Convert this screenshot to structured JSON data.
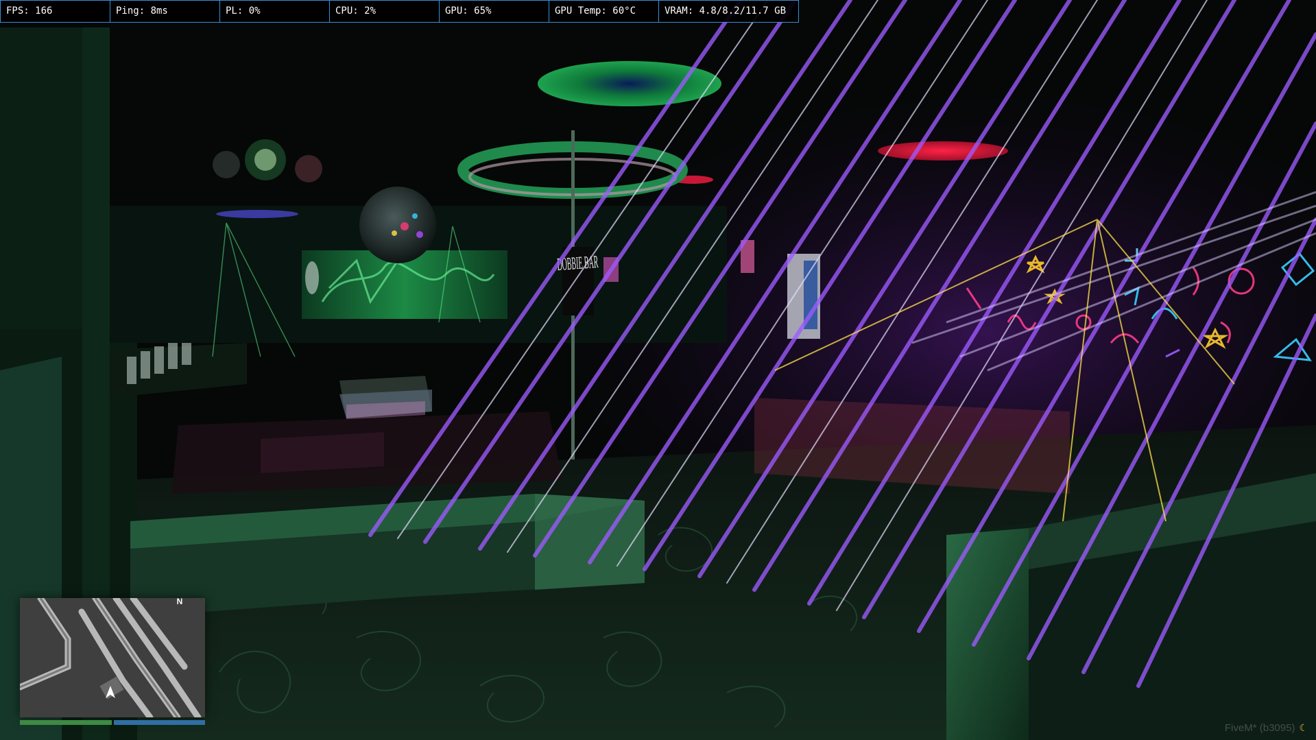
{
  "hud": {
    "perf": {
      "fps": "FPS: 166",
      "ping": "Ping: 8ms",
      "packet_loss": "PL: 0%",
      "cpu": "CPU: 2%",
      "gpu": "GPU: 65%",
      "gpu_temp": "GPU Temp: 60°C",
      "vram": "VRAM: 4.8/8.2/11.7 GB"
    },
    "minimap": {
      "north_label": "N",
      "player_marker_icon": "player-arrow-icon",
      "health_fraction": 1.0,
      "armor_fraction": 1.0
    }
  },
  "watermark": {
    "text": "FiveM* (b3095)",
    "icon": "moon-icon"
  },
  "scene": {
    "sign_text": "DOBBIE BAR"
  },
  "colors": {
    "overlay_border": "#3a8fd6",
    "health": "#3d8a44",
    "armor": "#2f6fa3",
    "laser_purple": "#9d5bff",
    "laser_white": "#e6ddff",
    "neon_green": "#2fd36a"
  }
}
